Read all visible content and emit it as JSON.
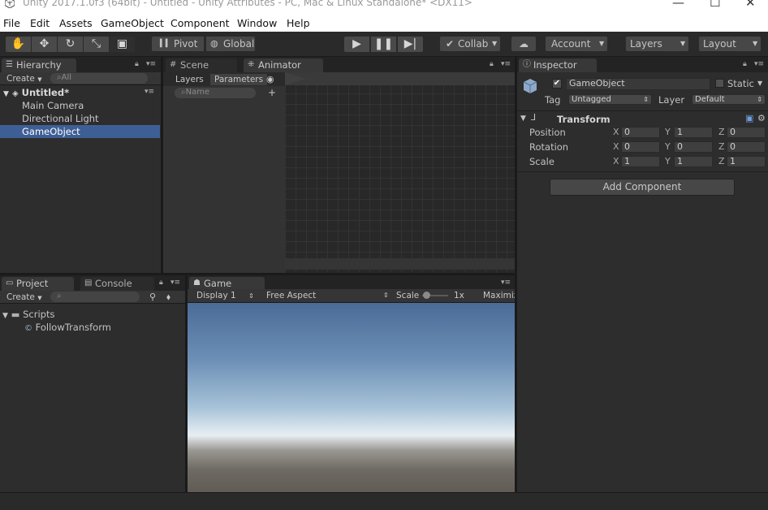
{
  "window": {
    "title": "Unity 2017.1.0f3 (64bit) - Untitled - Unity Attributes - PC, Mac & Linux Standalone* <DX11>"
  },
  "menu": [
    "File",
    "Edit",
    "Assets",
    "GameObject",
    "Component",
    "Window",
    "Help"
  ],
  "toolbar": {
    "pivot": "Pivot",
    "global": "Global",
    "collab": "Collab",
    "account": "Account",
    "layers": "Layers",
    "layout": "Layout"
  },
  "hierarchy": {
    "tab": "Hierarchy",
    "create": "Create",
    "search_placeholder": "All",
    "scene_name": "Untitled*",
    "items": [
      "Main Camera",
      "Directional Light",
      "GameObject"
    ],
    "selected_index": 2
  },
  "scene_tabs": {
    "scene": "Scene",
    "animator": "Animator"
  },
  "animator": {
    "layers_tab": "Layers",
    "parameters_tab": "Parameters",
    "search_placeholder": "Name",
    "add_symbol": "+"
  },
  "project": {
    "tab": "Project",
    "console_tab": "Console",
    "create": "Create",
    "folder": "Scripts",
    "file": "FollowTransform"
  },
  "game": {
    "tab": "Game",
    "display": "Display 1",
    "aspect": "Free Aspect",
    "scale_label": "Scale",
    "scale_value": "1x",
    "maximize": "Maximize On Play"
  },
  "inspector": {
    "tab": "Inspector",
    "object_name": "GameObject",
    "active": true,
    "static_label": "Static",
    "tag_label": "Tag",
    "tag_value": "Untagged",
    "layer_label": "Layer",
    "layer_value": "Default",
    "component": "Transform",
    "rows": [
      {
        "label": "Position",
        "x": "0",
        "y": "1",
        "z": "0"
      },
      {
        "label": "Rotation",
        "x": "0",
        "y": "0",
        "z": "0"
      },
      {
        "label": "Scale",
        "x": "1",
        "y": "1",
        "z": "1"
      }
    ],
    "axis_x": "X",
    "axis_y": "Y",
    "axis_z": "Z",
    "add_component": "Add Component"
  },
  "colors": {
    "selection": "#3e5f96",
    "panel": "#2d2d2d",
    "background": "#1e1e1e"
  }
}
